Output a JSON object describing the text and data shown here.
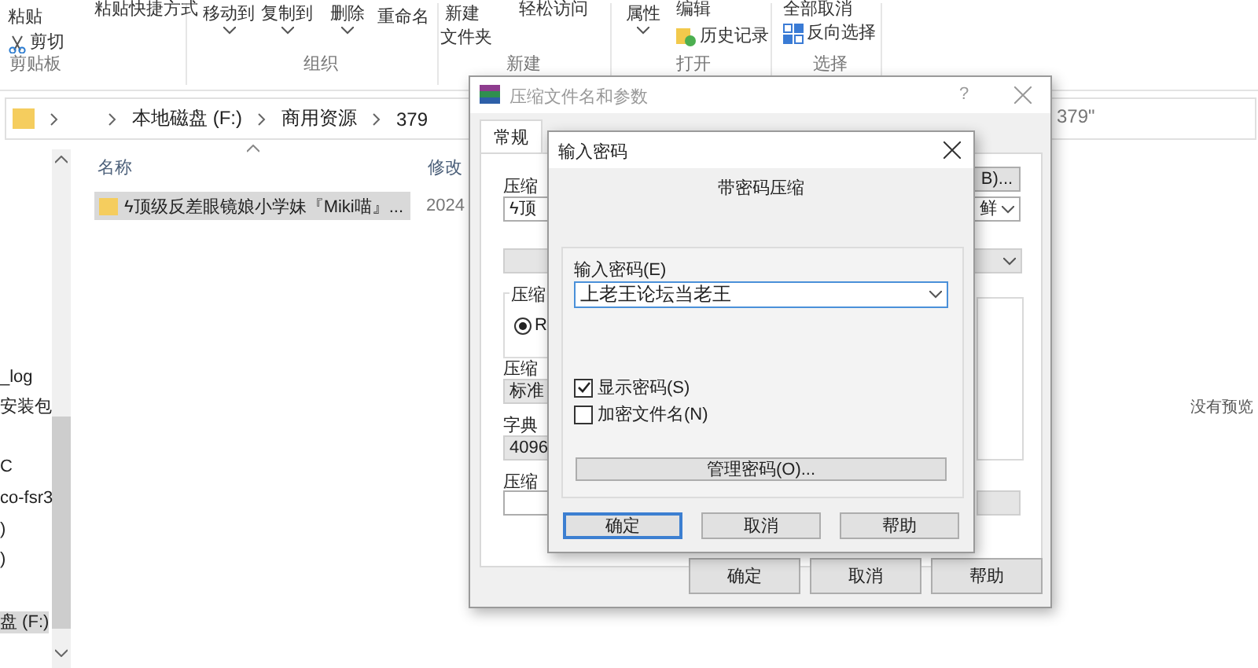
{
  "ribbon": {
    "commands": [
      {
        "label": "粘贴",
        "kind": "text"
      },
      {
        "label": "剪切",
        "kind": "scissors"
      },
      {
        "label": "粘贴快捷方式",
        "kind": "small"
      },
      {
        "label": "移动到",
        "kind": "dropdown"
      },
      {
        "label": "复制到",
        "kind": "dropdown"
      },
      {
        "label": "删除",
        "kind": "dropdown"
      },
      {
        "label": "重命名",
        "kind": "text"
      },
      {
        "label": "新建",
        "kind": "text"
      },
      {
        "label": "文件夹",
        "kind": "text"
      },
      {
        "label": "轻松访问",
        "kind": "small"
      },
      {
        "label": "属性",
        "kind": "dropdown"
      },
      {
        "label": "编辑",
        "kind": "small"
      },
      {
        "label": "历史记录",
        "kind": "history"
      },
      {
        "label": "全部取消",
        "kind": "small"
      },
      {
        "label": "反向选择",
        "kind": "invert"
      }
    ],
    "group_labels": [
      "剪贴板",
      "组织",
      "新建",
      "打开",
      "选择"
    ]
  },
  "address": {
    "crumbs": [
      "本地磁盘 (F:)",
      "商用资源",
      "379"
    ],
    "search": "379\""
  },
  "nav_items": [
    {
      "label": "_log",
      "selected": false
    },
    {
      "label": "安装包",
      "selected": false
    },
    {
      "label": "C",
      "selected": false
    },
    {
      "label": "co-fsr3",
      "selected": false
    },
    {
      "label": ")",
      "selected": false
    },
    {
      "label": ")",
      "selected": false
    },
    {
      "label": "盘 (F:)",
      "selected": true
    }
  ],
  "file_list": {
    "columns": [
      "名称",
      "修改"
    ],
    "rows": [
      {
        "name": "ϟ顶级反差眼镜娘小学妹『Miki喵』...",
        "date": "2024",
        "selected": true
      }
    ]
  },
  "preview_text": "没有预览",
  "archive_dialog": {
    "title": "压缩文件名和参数",
    "help": "?",
    "tabs": [
      {
        "label": "常规",
        "selected": true
      }
    ],
    "labels": [
      "压缩",
      "压缩",
      "字典",
      "压缩"
    ],
    "archive_name": "ϟ顶",
    "browse_button": "B)...",
    "profile_value": "鲜",
    "format_group": "压缩",
    "format_option": {
      "label": "R",
      "selected": true
    },
    "method_value": "标准",
    "dictionary_value": "4096",
    "buttons": [
      "确定",
      "取消",
      "帮助"
    ]
  },
  "password_dialog": {
    "title": "输入密码",
    "heading": "带密码压缩",
    "password_label": "输入密码(E)",
    "password_value": "上老王论坛当老王",
    "options": [
      {
        "label": "显示密码(S)",
        "checked": true
      },
      {
        "label": "加密文件名(N)",
        "checked": false
      }
    ],
    "manage_button": "管理密码(O)...",
    "buttons": [
      {
        "label": "确定",
        "default": true
      },
      {
        "label": "取消",
        "default": false
      },
      {
        "label": "帮助",
        "default": false
      }
    ]
  }
}
